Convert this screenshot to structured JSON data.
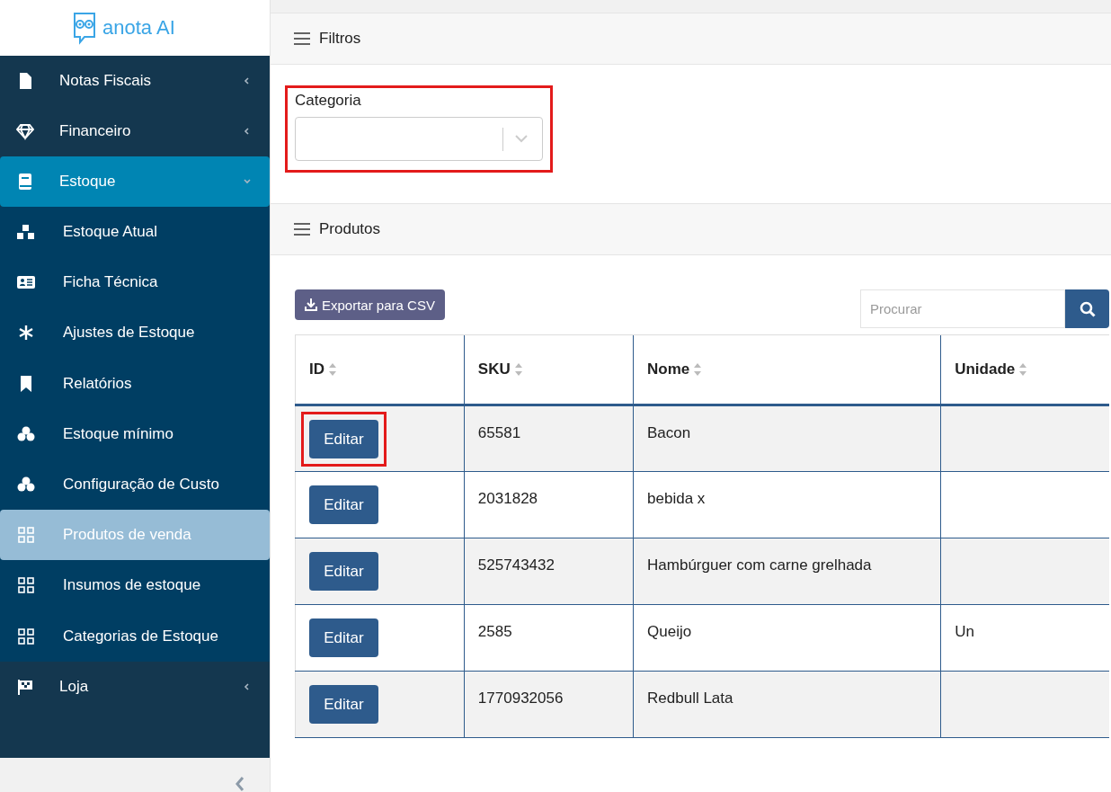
{
  "brand": {
    "name": "anota AI"
  },
  "sidebar": {
    "items": [
      {
        "label": "Notas Fiscais",
        "expanded": false,
        "selected": false
      },
      {
        "label": "Financeiro",
        "expanded": false,
        "selected": false
      },
      {
        "label": "Estoque",
        "expanded": true,
        "selected": true,
        "children": [
          {
            "label": "Estoque Atual",
            "selected": false
          },
          {
            "label": "Ficha Técnica",
            "selected": false
          },
          {
            "label": "Ajustes de Estoque",
            "selected": false
          },
          {
            "label": "Relatórios",
            "selected": false
          },
          {
            "label": "Estoque mínimo",
            "selected": false
          },
          {
            "label": "Configuração de Custo",
            "selected": false
          },
          {
            "label": "Produtos de venda",
            "selected": true
          },
          {
            "label": "Insumos de estoque",
            "selected": false
          },
          {
            "label": "Categorias de Estoque",
            "selected": false
          }
        ]
      },
      {
        "label": "Loja",
        "expanded": false,
        "selected": false
      }
    ]
  },
  "filters": {
    "title": "Filtros",
    "highlighted": true,
    "field": {
      "label": "Categoria"
    }
  },
  "products": {
    "title": "Produtos",
    "export_button": "Exportar para CSV",
    "search": {
      "placeholder": "Procurar"
    },
    "table": {
      "columns": [
        "ID",
        "SKU",
        "Nome",
        "Unidade"
      ],
      "rows": [
        {
          "action": "Editar",
          "sku": "65581",
          "nome": "Bacon",
          "highlighted": true
        },
        {
          "action": "Editar",
          "sku": "2031828",
          "nome": "bebida x",
          "highlighted": false
        },
        {
          "action": "Editar",
          "sku": "525743432",
          "nome": "Hambúrguer com carne grelhada",
          "highlighted": false
        },
        {
          "action": "Editar",
          "sku": "2585",
          "nome": "Queijo",
          "unidade": "Un",
          "highlighted": false
        },
        {
          "action": "Editar",
          "sku": "1770932056",
          "nome": "Redbull Lata",
          "highlighted": false
        }
      ]
    }
  }
}
